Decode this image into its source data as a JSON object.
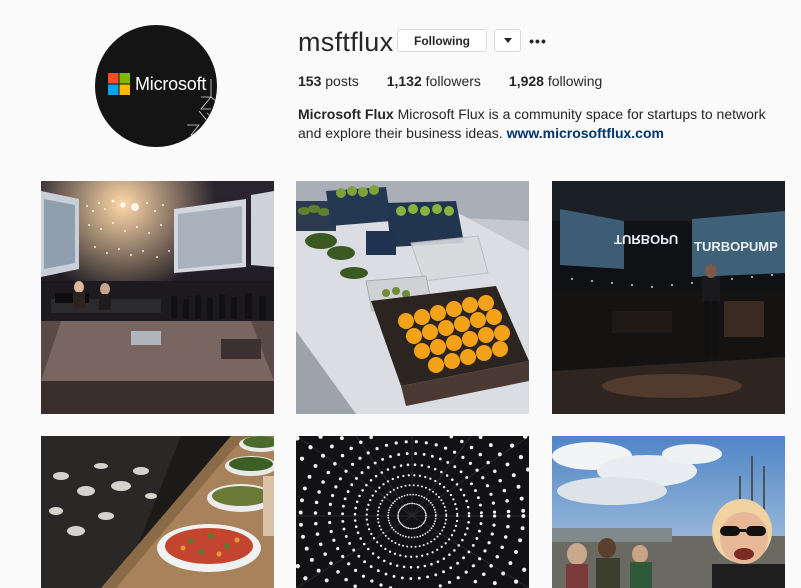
{
  "profile": {
    "username": "msftflux",
    "following_label": "Following",
    "more_label": "•••",
    "avatar_logo_text": "Microsoft",
    "stats": {
      "posts_count": "153",
      "posts_label": "posts",
      "followers_count": "1,132",
      "followers_label": "followers",
      "following_count": "1,928",
      "following_label": "following"
    },
    "bio": {
      "name": "Microsoft Flux",
      "text": "Microsoft Flux is a community space for startups to network and explore their business ideas.",
      "link": "www.microsoftflux.com"
    }
  },
  "posts": [
    {
      "description": "stage with screens and lights"
    },
    {
      "description": "table with fruit and vegetables"
    },
    {
      "description": "dark stage with TURBOPUMP screens"
    },
    {
      "description": "food bowls on table"
    },
    {
      "description": "ceiling of lights"
    },
    {
      "description": "smiling people outdoors"
    }
  ],
  "colors": {
    "link": "#003569",
    "border": "#dbdbdb",
    "text": "#262626",
    "background": "#fafafa"
  },
  "tile_texts": {
    "turbopump_left": "TURBOPU",
    "turbopump_right": "TURBOPUMP"
  }
}
